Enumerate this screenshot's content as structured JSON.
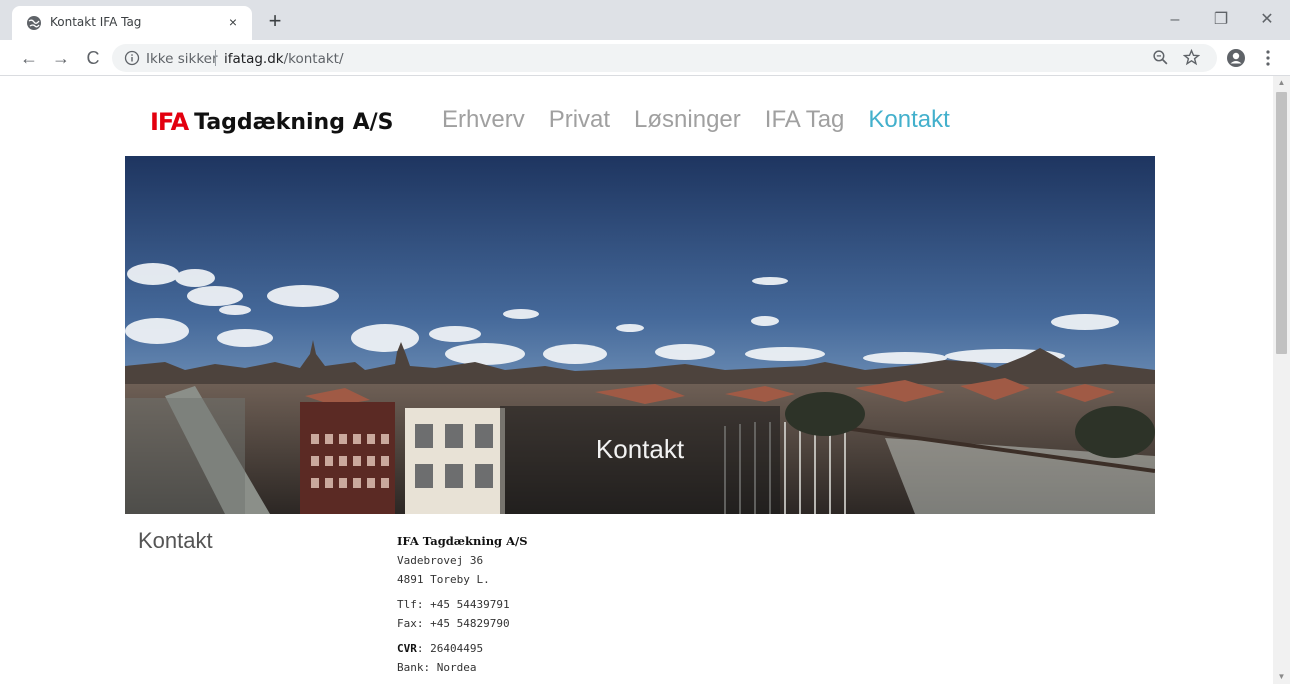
{
  "browser": {
    "tab_title": "Kontakt IFA Tag",
    "tab_close": "×",
    "new_tab": "+",
    "security_label": "Ikke sikker",
    "url_host": "ifatag.dk",
    "url_path": "/kontakt/",
    "nav": {
      "back": "←",
      "forward": "→",
      "reload": "C"
    },
    "window": {
      "minimize": "–",
      "restore": "❐",
      "close": "✕"
    }
  },
  "site": {
    "logo_mark": "IFA",
    "logo_name": "Tagdækning A/S",
    "nav": [
      {
        "label": "Erhverv"
      },
      {
        "label": "Privat"
      },
      {
        "label": "Løsninger"
      },
      {
        "label": "IFA Tag"
      },
      {
        "label": "Kontakt",
        "active": true
      }
    ]
  },
  "hero": {
    "title": "Kontakt"
  },
  "content": {
    "section_title": "Kontakt",
    "company": "IFA Tagdækning A/S",
    "address_line1": "Vadebrovej 36",
    "address_line2": "4891 Toreby L.",
    "phone": "Tlf: +45 54439791",
    "fax": "Fax: +45 54829790",
    "cvr_label": "CVR",
    "cvr_value": ": 26404495",
    "bank": "Bank: Nordea"
  },
  "colors": {
    "accent": "#43b0cc",
    "logo_red": "#e3000f",
    "nav_inactive": "#a0a0a0"
  }
}
